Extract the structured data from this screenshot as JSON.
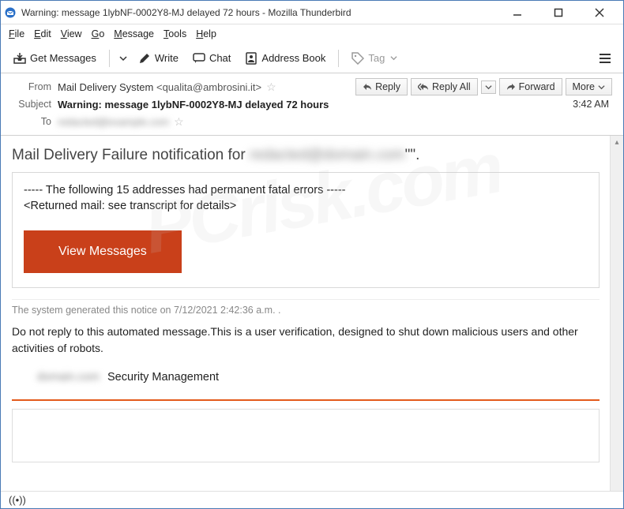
{
  "window": {
    "title": "Warning: message 1lybNF-0002Y8-MJ delayed 72 hours - Mozilla Thunderbird"
  },
  "menubar": {
    "file": "File",
    "edit": "Edit",
    "view": "View",
    "go": "Go",
    "message": "Message",
    "tools": "Tools",
    "help": "Help"
  },
  "toolbar": {
    "get_messages": "Get Messages",
    "write": "Write",
    "chat": "Chat",
    "address_book": "Address Book",
    "tag": "Tag"
  },
  "header": {
    "from_label": "From",
    "from_name": "Mail Delivery System",
    "from_email": "<qualita@ambrosini.it>",
    "subject_label": "Subject",
    "subject_value": "Warning: message 1lybNF-0002Y8-MJ delayed 72 hours",
    "to_label": "To",
    "to_value_redacted": "redacted@example.com",
    "time": "3:42 AM",
    "reply": "Reply",
    "reply_all": "Reply All",
    "forward": "Forward",
    "more": "More"
  },
  "body": {
    "title_prefix": "Mail Delivery Failure notification for ",
    "title_redacted": "redacted@domain.com",
    "title_suffix": "\"\".",
    "error_line": " ----- The following 15 addresses had permanent fatal errors -----",
    "returned_line": "<Returned mail: see transcript for details>",
    "view_btn": "View Messages",
    "gen_notice": "The system generated this notice on 7/12/2021 2:42:36 a.m. .",
    "no_reply": "Do not reply to this automated message.This is a user verification, designed to shut down malicious users and other  activities of  robots.",
    "sec_redacted": "domain.com",
    "sec_mgmt": "Security Management"
  },
  "statusbar": {
    "activity": "((•))"
  },
  "icons": {
    "tb": "tb-app-icon",
    "down": "▾",
    "arrow_reply": "↩",
    "arrow_fwd": "→"
  }
}
